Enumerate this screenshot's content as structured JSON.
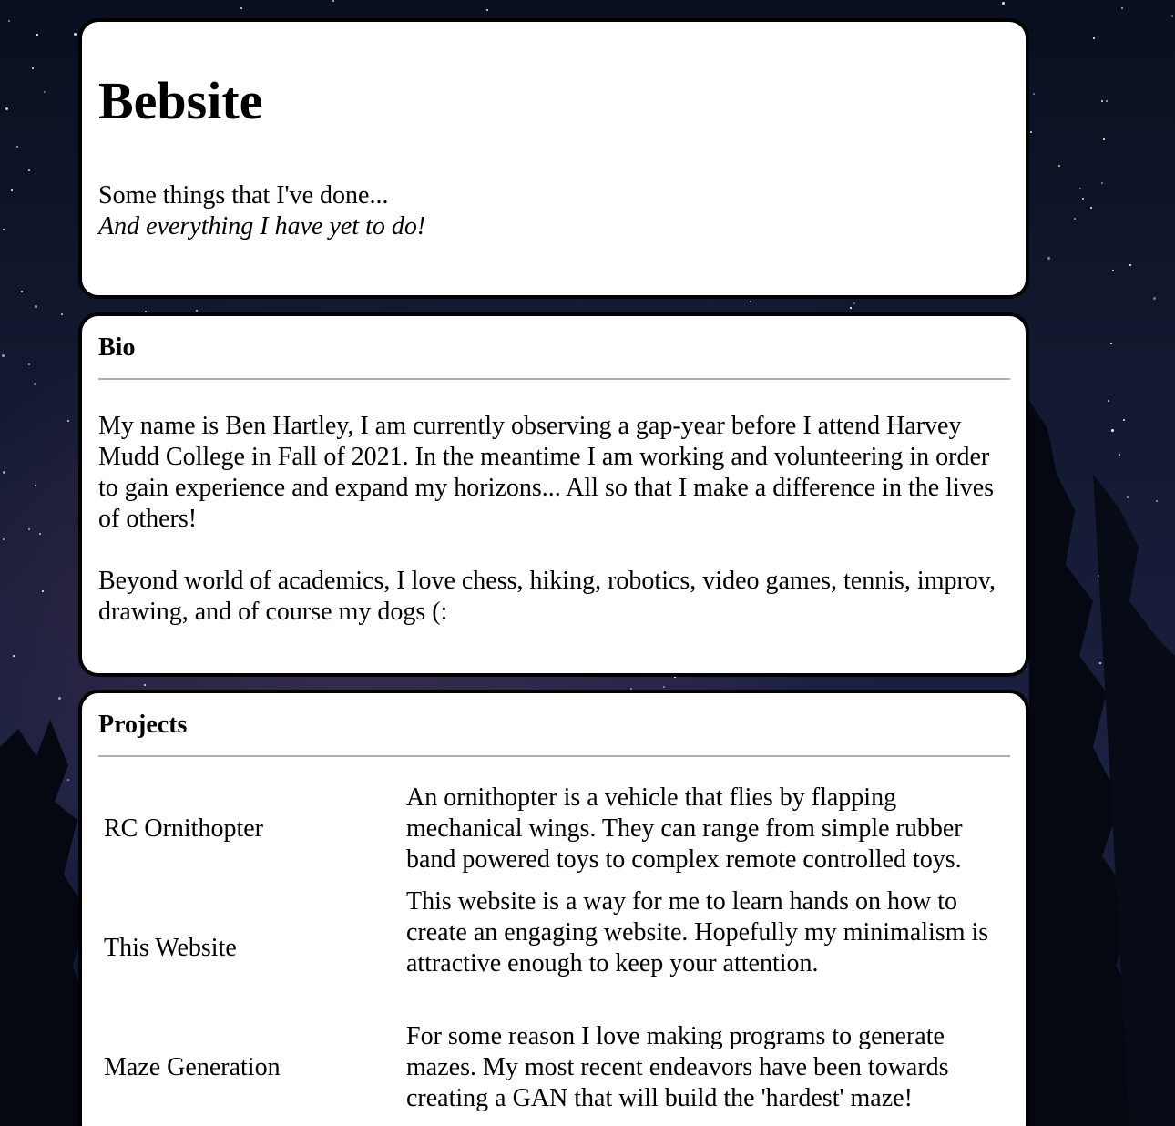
{
  "header": {
    "title": "Bebsite",
    "tagline": "Some things that I've done...",
    "tagline_italic": "And everything I have yet to do!"
  },
  "bio": {
    "heading": "Bio",
    "paragraphs": [
      "My name is Ben Hartley, I am currently observing a gap-year before I attend Harvey Mudd College in Fall of 2021. In the meantime I am working and volunteering in order to gain experience and expand my horizons... All so that I make a difference in the lives of others!",
      "Beyond world of academics, I love chess, hiking, robotics, video games, tennis, improv, drawing, and of course my dogs (:"
    ]
  },
  "projects": {
    "heading": "Projects",
    "items": [
      {
        "name": "RC Ornithopter",
        "description": "An ornithopter is a vehicle that flies by flapping mechanical wings. They can range from simple rubber band powered toys to complex remote controlled toys."
      },
      {
        "name": "This Website",
        "description": "This website is a way for me to learn hands on how to create an engaging website. Hopefully my minimalism is attractive enough to keep your attention."
      },
      {
        "name": "Maze Generation",
        "description": "For some reason I love making programs to generate mazes. My most recent endeavors have been towards creating a GAN that will build the 'hardest' maze!"
      }
    ]
  },
  "colors": {
    "card_background": "#ffffff",
    "card_border": "#000000",
    "rule": "#b0b0b0",
    "sky": "#0b1022"
  }
}
